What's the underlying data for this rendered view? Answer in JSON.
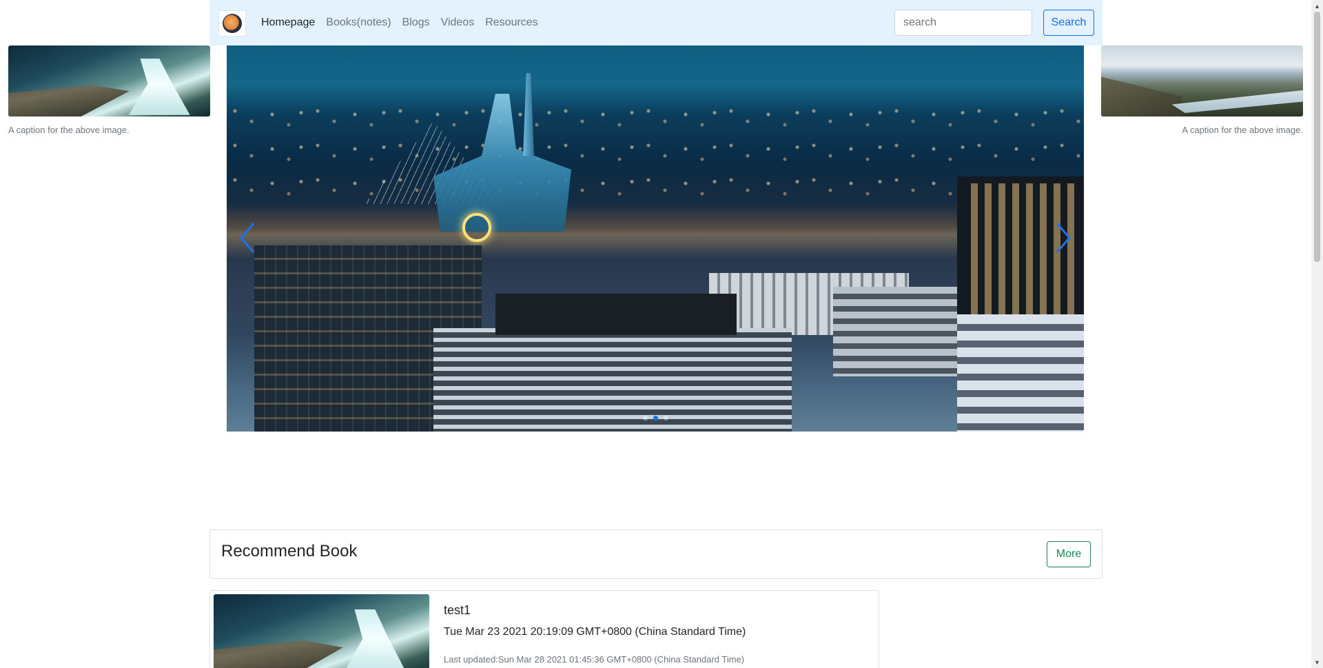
{
  "navbar": {
    "logo_name": "site-logo",
    "links": [
      {
        "label": "Homepage",
        "active": true
      },
      {
        "label": "Books(notes)",
        "active": false
      },
      {
        "label": "Blogs",
        "active": false
      },
      {
        "label": "Videos",
        "active": false
      },
      {
        "label": "Resources",
        "active": false
      }
    ],
    "search": {
      "placeholder": "search",
      "value": ""
    },
    "search_button": "Search"
  },
  "side_images": {
    "left": {
      "caption": "A caption for the above image."
    },
    "right": {
      "caption": "A caption for the above image."
    }
  },
  "carousel": {
    "slide_count": 3,
    "active_index": 1,
    "prev_icon": "chevron-left-icon",
    "next_icon": "chevron-right-icon"
  },
  "recommend": {
    "title": "Recommend Book",
    "more_button": "More",
    "books": [
      {
        "title": "test1",
        "date": "Tue Mar 23 2021 20:19:09 GMT+0800 (China Standard Time)",
        "updated": "Last updated:Sun Mar 28 2021 01:45:36 GMT+0800 (China Standard Time)"
      }
    ]
  },
  "colors": {
    "navbar_bg": "#e3f2fd",
    "primary": "#0d6efd",
    "success": "#198754",
    "muted": "#6c757d",
    "indicator_active": "#1a73e8"
  }
}
